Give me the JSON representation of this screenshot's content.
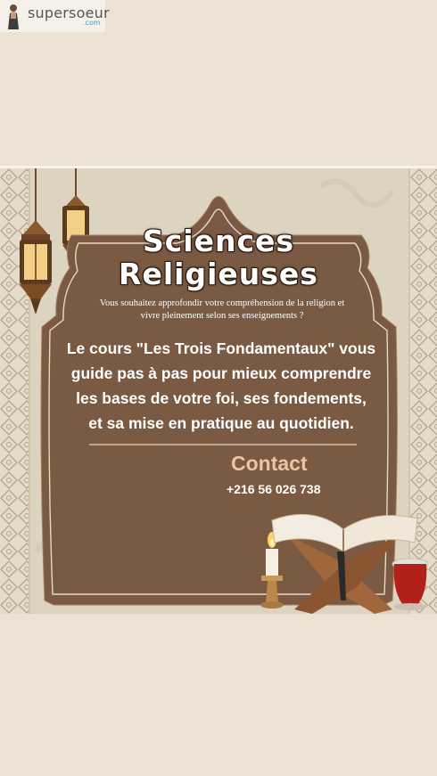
{
  "brand": {
    "name": "supersoeur",
    "tld": ".com"
  },
  "poster": {
    "title_line1": "Sciences",
    "title_line2": "Religieuses",
    "intro": "Vous souhaitez approfondir votre compréhension de la religion et vivre pleinement selon ses enseignements ?",
    "body_lines": [
      "Le cours \"Les Trois Fondamentaux\" vous",
      "guide pas à pas pour mieux comprendre",
      "les bases de votre foi, ses fondements,",
      "et sa mise en pratique au quotidien."
    ],
    "contact_label": "Contact",
    "contact_phone": "+216 56 026 738"
  },
  "colors": {
    "background": "#ebe2d3",
    "poster_bg": "#ddd3c1",
    "frame_brown": "#7b5a43",
    "accent_text": "#e6c7a2"
  }
}
